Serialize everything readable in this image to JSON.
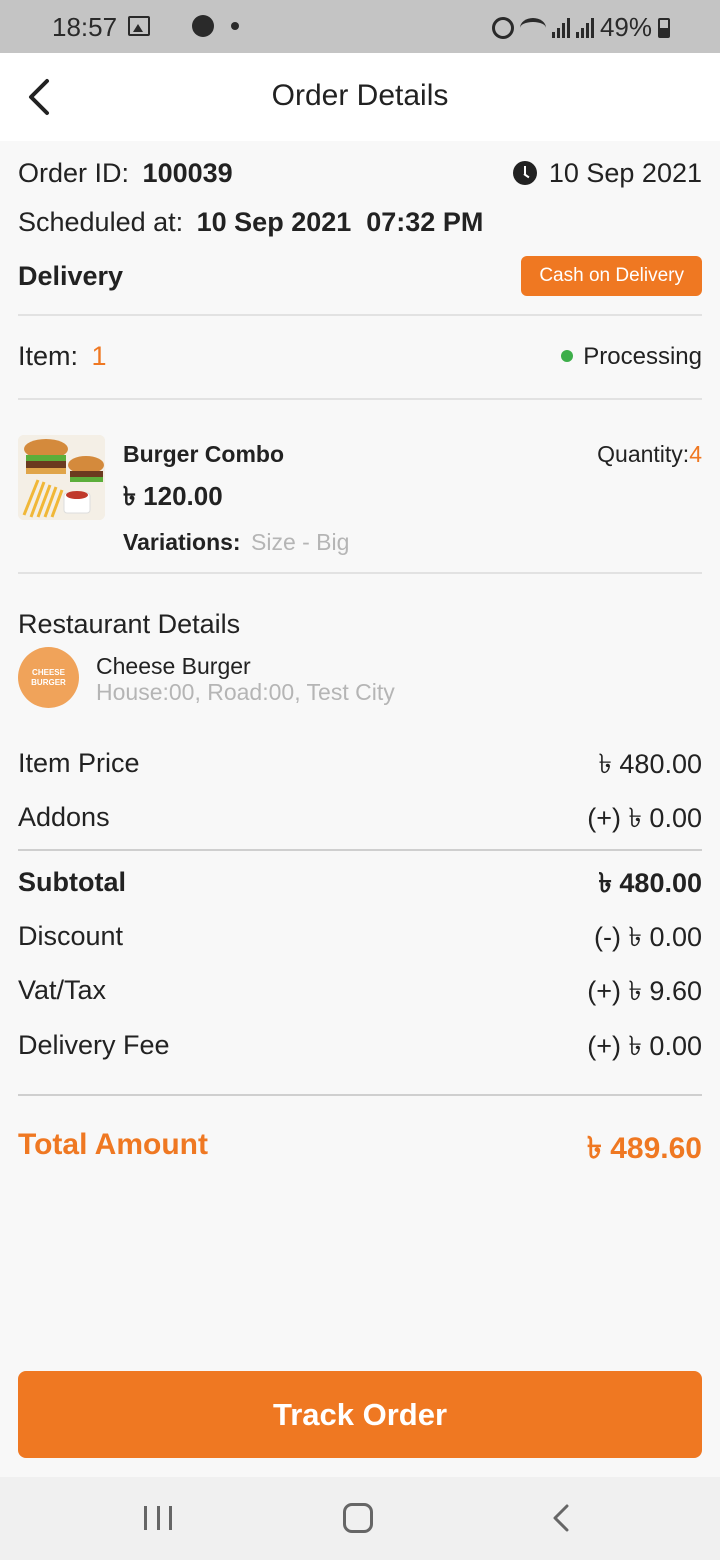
{
  "status_bar": {
    "time": "18:57",
    "battery": "49%"
  },
  "header": {
    "title": "Order Details"
  },
  "order": {
    "id_label": "Order ID:",
    "id_value": "100039",
    "date": "10 Sep 2021",
    "scheduled_label": "Scheduled at:",
    "scheduled_value": "10 Sep 2021  07:32 PM",
    "type": "Delivery",
    "payment_badge": "Cash on Delivery",
    "item_label": "Item:",
    "item_count": "1",
    "status": "Processing"
  },
  "product": {
    "name": "Burger Combo",
    "price": "৳ 120.00",
    "quantity_label": "Quantity:",
    "quantity_value": "4",
    "variations_label": "Variations:",
    "variations_value": "Size - Big"
  },
  "restaurant": {
    "section_title": "Restaurant Details",
    "name": "Cheese Burger",
    "address": "House:00, Road:00, Test City",
    "logo_text_line1": "CHEESE",
    "logo_text_line2": "BURGER"
  },
  "summary": {
    "item_price_label": "Item Price",
    "item_price_value": "৳ 480.00",
    "addons_label": "Addons",
    "addons_value": "(+) ৳ 0.00",
    "subtotal_label": "Subtotal",
    "subtotal_value": "৳ 480.00",
    "discount_label": "Discount",
    "discount_value": "(-) ৳ 0.00",
    "vat_label": "Vat/Tax",
    "vat_value": "(+) ৳ 9.60",
    "delivery_fee_label": "Delivery Fee",
    "delivery_fee_value": "(+) ৳ 0.00",
    "total_label": "Total Amount",
    "total_value": "৳ 489.60"
  },
  "actions": {
    "track_order": "Track Order"
  },
  "colors": {
    "accent": "#ef7822",
    "status_processing": "#3dae4a"
  }
}
